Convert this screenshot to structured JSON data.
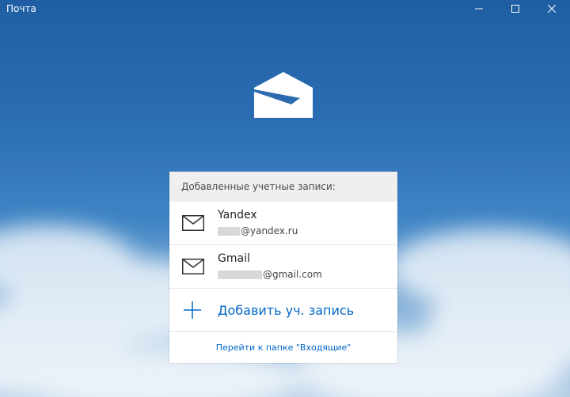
{
  "window": {
    "title": "Почта"
  },
  "panel": {
    "header": "Добавленные учетные записи:",
    "accounts": [
      {
        "name": "Yandex",
        "email_visible": "@yandex.ru",
        "icon": "mail-icon"
      },
      {
        "name": "Gmail",
        "email_visible": "@gmail.com",
        "icon": "mail-icon"
      }
    ],
    "add_account_label": "Добавить уч. запись",
    "inbox_link_label": "Перейти к папке \"Входящие\""
  },
  "colors": {
    "accent": "#0066c7",
    "header_bg": "#efefef"
  }
}
